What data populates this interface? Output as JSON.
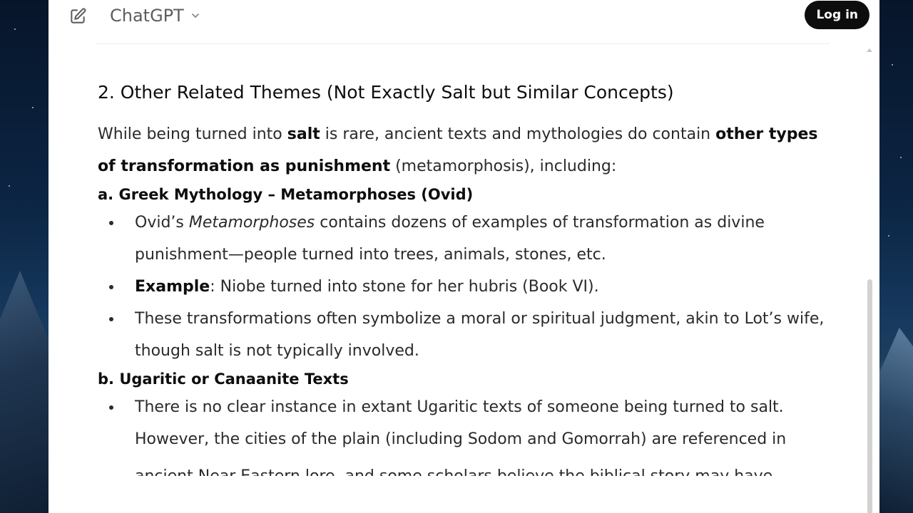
{
  "app": {
    "model_name": "ChatGPT",
    "login_label": "Log in",
    "icons": {
      "edit": "new-chat-edit-icon",
      "model_dropdown": "chevron-down-icon"
    }
  },
  "message": {
    "heading": "2. Other Related Themes (Not Exactly Salt but Similar Concepts)",
    "intro": {
      "t1": "While being turned into ",
      "b1": "salt",
      "t2": " is rare, ancient texts and mythologies do contain ",
      "b2": "other types of transformation as punishment",
      "t3": " (metamorphosis), including:"
    },
    "section_a": {
      "title": "a. Greek Mythology – Metamorphoses (Ovid)",
      "bullet1": {
        "t1": "Ovid’s ",
        "i1": "Metamorphoses",
        "t2": " contains dozens of examples of transformation as divine punishment—people turned into trees, animals, stones, etc."
      },
      "bullet2": {
        "b1": "Example",
        "t1": ": Niobe turned into stone for her hubris (Book VI)."
      },
      "bullet3": {
        "t1": "These transformations often symbolize a moral or spiritual judgment, akin to Lot’s wife, though salt is not typically involved."
      }
    },
    "section_b": {
      "title": "b. Ugaritic or Canaanite Texts",
      "bullet1": {
        "t1": "There is no clear instance in extant Ugaritic texts of someone being turned to salt. However, the cities of the plain (including Sodom and Gomorrah) are referenced in",
        "t2": "ancient Near Eastern lore, and some scholars believe the biblical story may have"
      }
    }
  },
  "colors": {
    "accent": "#0d0d0d",
    "text": "#2a2a2a",
    "background": "#ffffff"
  }
}
